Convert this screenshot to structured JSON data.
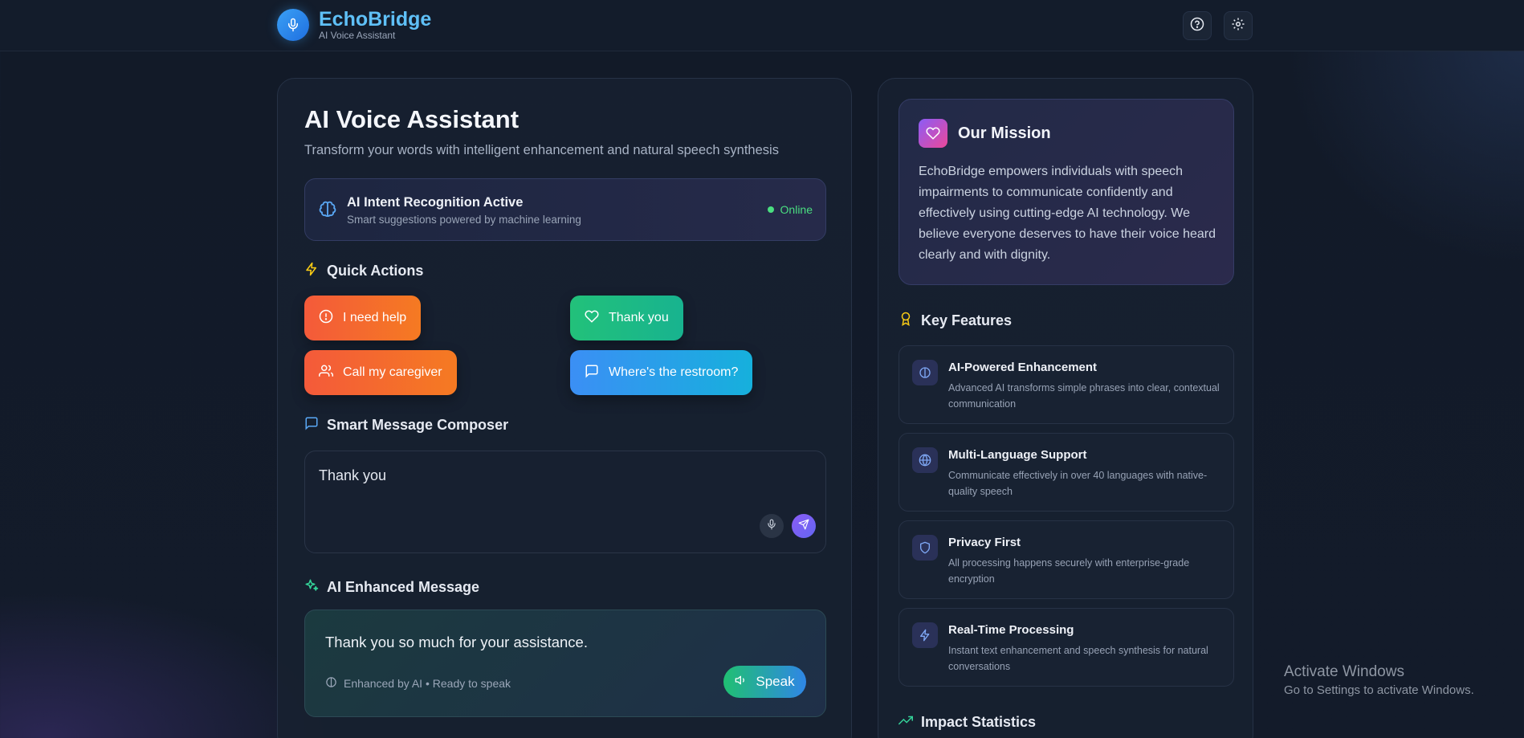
{
  "header": {
    "brand_name": "EchoBridge",
    "brand_sub": "AI Voice Assistant",
    "help_icon": "help-circle-icon",
    "settings_icon": "gear-icon"
  },
  "main": {
    "title": "AI Voice Assistant",
    "subtitle": "Transform your words with intelligent enhancement and natural speech synthesis",
    "intent": {
      "title": "AI Intent Recognition Active",
      "subtitle": "Smart suggestions powered by machine learning",
      "status": "Online"
    },
    "quick_actions_label": "Quick Actions",
    "quick_actions": [
      {
        "label": "I need help",
        "icon": "alert-circle-icon"
      },
      {
        "label": "Thank you",
        "icon": "heart-icon"
      },
      {
        "label": "Call my caregiver",
        "icon": "users-icon"
      },
      {
        "label": "Where's the restroom?",
        "icon": "message-square-icon"
      }
    ],
    "composer_label": "Smart Message Composer",
    "composer_value": "Thank you",
    "enhanced_label": "AI Enhanced Message",
    "enhanced_text": "Thank you so much for your assistance.",
    "enhanced_meta": "Enhanced by AI • Ready to speak",
    "speak_label": "Speak"
  },
  "sidebar": {
    "mission_title": "Our Mission",
    "mission_body": "EchoBridge empowers individuals with speech impairments to communicate confidently and effectively using cutting-edge AI technology. We believe everyone deserves to have their voice heard clearly and with dignity.",
    "features_label": "Key Features",
    "features": [
      {
        "title": "AI-Powered Enhancement",
        "desc": "Advanced AI transforms simple phrases into clear, contextual communication",
        "icon": "brain-icon"
      },
      {
        "title": "Multi-Language Support",
        "desc": "Communicate effectively in over 40 languages with native-quality speech",
        "icon": "globe-icon"
      },
      {
        "title": "Privacy First",
        "desc": "All processing happens securely with enterprise-grade encryption",
        "icon": "shield-icon"
      },
      {
        "title": "Real-Time Processing",
        "desc": "Instant text enhancement and speech synthesis for natural conversations",
        "icon": "zap-icon"
      }
    ],
    "impact_label": "Impact Statistics"
  },
  "watermark": {
    "line1": "Activate Windows",
    "line2": "Go to Settings to activate Windows."
  },
  "colors": {
    "accent_blue": "#3aa0f5",
    "online_green": "#4ade80",
    "orange": "#f45a3a",
    "purple": "#8b5cf6"
  }
}
